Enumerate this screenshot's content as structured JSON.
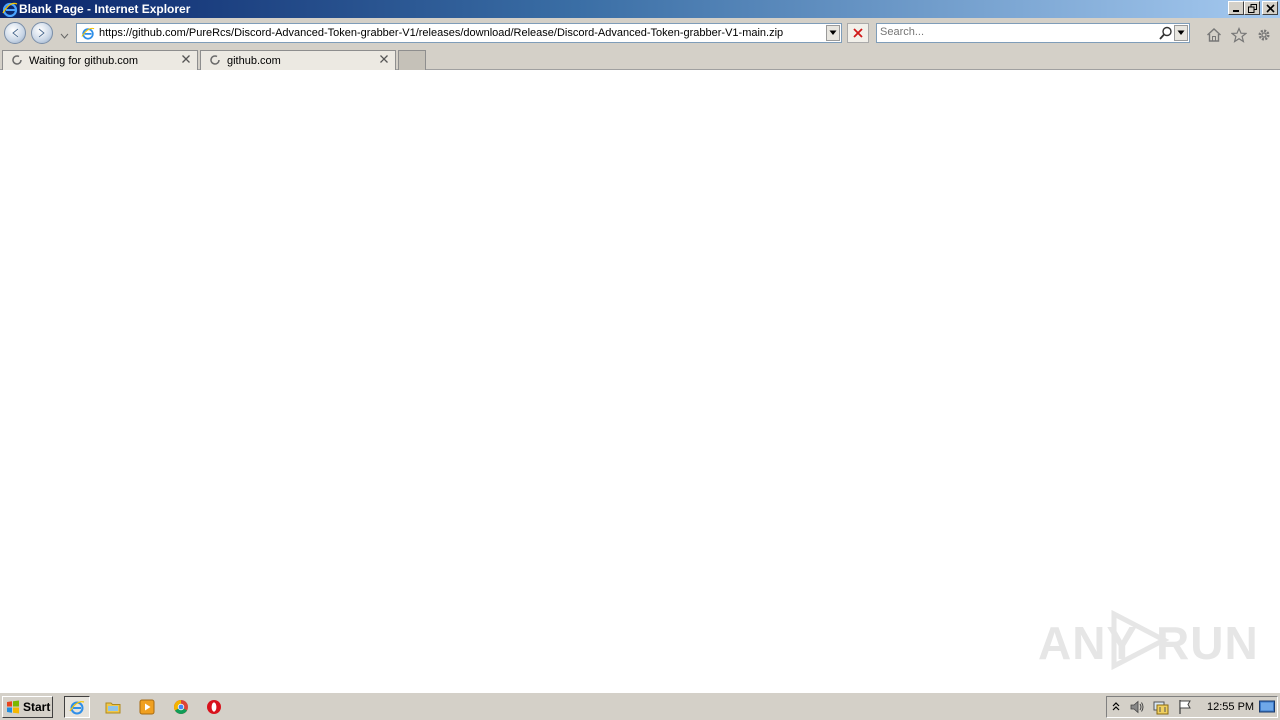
{
  "window": {
    "title": "Blank Page - Internet Explorer"
  },
  "navigation": {
    "address": "https://github.com/PureRcs/Discord-Advanced-Token-grabber-V1/releases/download/Release/Discord-Advanced-Token-grabber-V1-main.zip",
    "search_placeholder": "Search..."
  },
  "tabs": [
    {
      "label": "Waiting for github.com"
    },
    {
      "label": "github.com"
    }
  ],
  "taskbar": {
    "start_label": "Start",
    "clock": "12:55 PM"
  },
  "watermark": {
    "left": "ANY",
    "right": "RUN"
  },
  "colors": {
    "titlebar_start": "#0a246a",
    "titlebar_end": "#a6caf0",
    "chrome": "#d4d0c8"
  }
}
